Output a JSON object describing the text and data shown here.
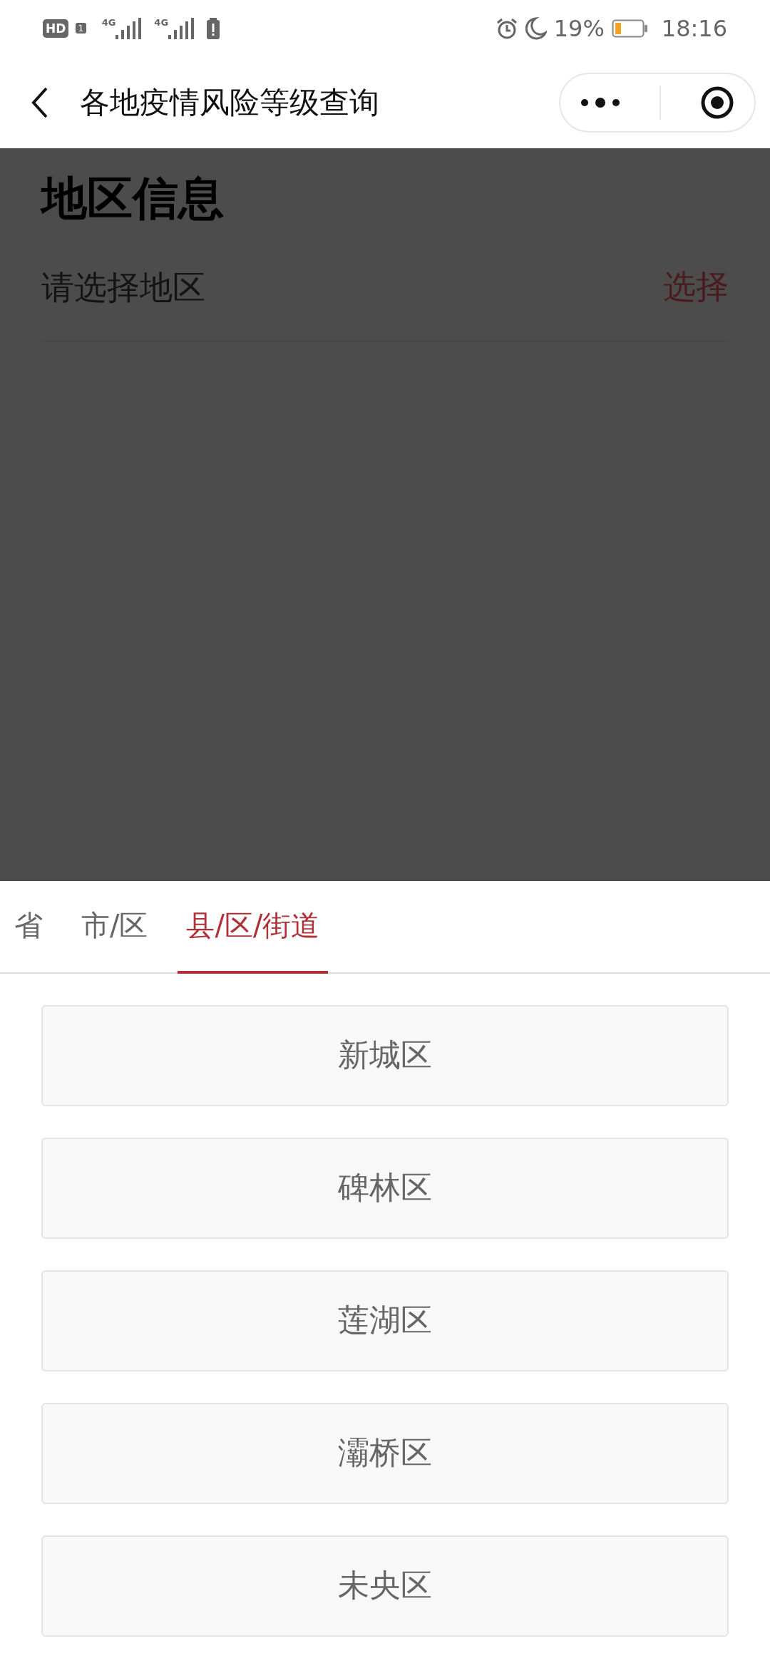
{
  "status_bar": {
    "hd": "HD",
    "sim": "1",
    "signals": [
      {
        "label": "4G"
      },
      {
        "label": "4G"
      }
    ],
    "battery_percent": "19%",
    "time": "18:16"
  },
  "header": {
    "title": "各地疫情风险等级查询"
  },
  "region_info": {
    "title": "地区信息",
    "placeholder": "请选择地区",
    "action": "选择"
  },
  "tabs": [
    {
      "label": "省",
      "selected": false
    },
    {
      "label": "市/区",
      "selected": false
    },
    {
      "label": "县/区/街道",
      "selected": true
    }
  ],
  "options": [
    "新城区",
    "碑林区",
    "莲湖区",
    "灞桥区",
    "未央区"
  ]
}
